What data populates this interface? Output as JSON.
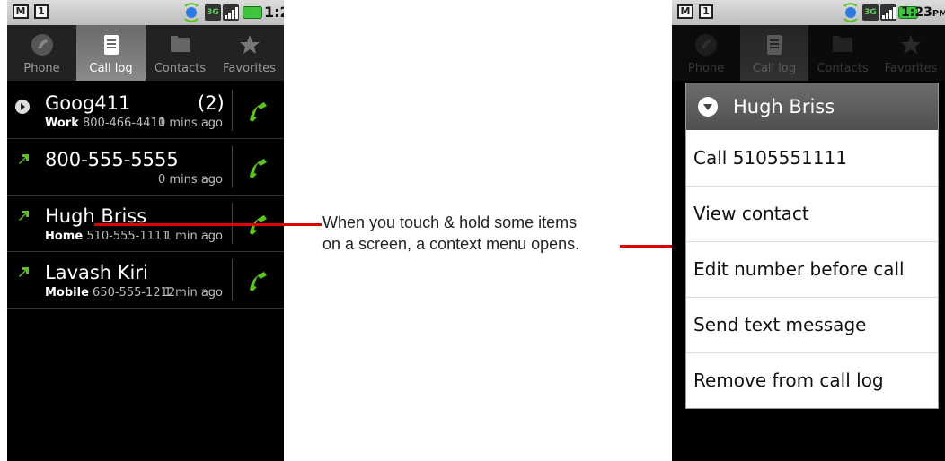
{
  "status_bar": {
    "time": "1:23",
    "ampm": "PM",
    "network": "3G"
  },
  "tabs": [
    {
      "label": "Phone",
      "icon": "phone-icon"
    },
    {
      "label": "Call log",
      "icon": "call-log-icon"
    },
    {
      "label": "Contacts",
      "icon": "contacts-icon"
    },
    {
      "label": "Favorites",
      "icon": "star-icon"
    }
  ],
  "call_log": [
    {
      "name": "Goog411",
      "count": "(2)",
      "type_label": "Work",
      "number": "800-466-4411",
      "ago": "0 mins ago",
      "icon": "play-circle-icon"
    },
    {
      "name": "800-555-5555",
      "count": "",
      "type_label": "",
      "number": "",
      "ago": "0 mins ago",
      "icon": "outgoing-call-arrow-icon"
    },
    {
      "name": "Hugh Briss",
      "count": "",
      "type_label": "Home",
      "number": "510-555-1111",
      "ago": "1 min ago",
      "icon": "outgoing-call-arrow-icon"
    },
    {
      "name": "Lavash Kiri",
      "count": "",
      "type_label": "Mobile",
      "number": "650-555-1212",
      "ago": "1 min ago",
      "icon": "outgoing-call-arrow-icon"
    }
  ],
  "caption": {
    "line1": "When you touch & hold some items",
    "line2": "on a screen, a context menu opens."
  },
  "context_menu": {
    "title": "Hugh Briss",
    "items": [
      "Call 5105551111",
      "View contact",
      "Edit number before call",
      "Send text message",
      "Remove from call log"
    ]
  },
  "colors": {
    "call_green": "#5cc21f",
    "callout_red": "#e00000",
    "active_tab": "#7a7a7a"
  }
}
